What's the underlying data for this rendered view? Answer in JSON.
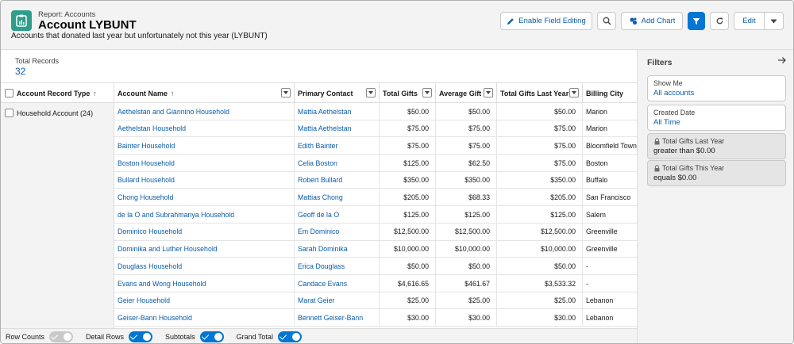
{
  "header": {
    "breadcrumb": "Report: Accounts",
    "title": "Account LYBUNT",
    "description": "Accounts that donated last year but unfortunately not this year (LYBUNT)",
    "buttons": {
      "enable_field_editing": "Enable Field Editing",
      "add_chart": "Add Chart",
      "edit": "Edit"
    }
  },
  "summary": {
    "total_records_label": "Total Records",
    "total_records_value": "32"
  },
  "table": {
    "columns": {
      "record_type": "Account Record Type",
      "account_name": "Account Name",
      "primary_contact": "Primary Contact",
      "total_gifts": "Total Gifts",
      "average_gift": "Average Gift",
      "total_gifts_last_year": "Total Gifts Last Year",
      "billing_city": "Billing City"
    },
    "sort_indicator": "↑",
    "group_label": "Household Account (24)",
    "rows": [
      {
        "account": "Aethelstan and Giannino Household",
        "contact": "Mattia Aethelstan",
        "total": "$50.00",
        "avg": "$50.00",
        "last": "$50.00",
        "city": "Marion"
      },
      {
        "account": "Aethelstan Household",
        "contact": "Mattia Aethelstan",
        "total": "$75.00",
        "avg": "$75.00",
        "last": "$75.00",
        "city": "Marion"
      },
      {
        "account": "Bainter Household",
        "contact": "Edith Bainter",
        "total": "$75.00",
        "avg": "$75.00",
        "last": "$75.00",
        "city": "Bloomfield Towns"
      },
      {
        "account": "Boston Household",
        "contact": "Celia Boston",
        "total": "$125.00",
        "avg": "$62.50",
        "last": "$75.00",
        "city": "Boston"
      },
      {
        "account": "Bullard Household",
        "contact": "Robert Bullard",
        "total": "$350.00",
        "avg": "$350.00",
        "last": "$350.00",
        "city": "Buffalo"
      },
      {
        "account": "Chong Household",
        "contact": "Mattias Chong",
        "total": "$205.00",
        "avg": "$68.33",
        "last": "$205.00",
        "city": "San Francisco"
      },
      {
        "account": "de la O and Subrahmanya Household",
        "contact": "Geoff de la O",
        "total": "$125.00",
        "avg": "$125.00",
        "last": "$125.00",
        "city": "Salem"
      },
      {
        "account": "Dominico Household",
        "contact": "Em Dominico",
        "total": "$12,500.00",
        "avg": "$12,500.00",
        "last": "$12,500.00",
        "city": "Greenville"
      },
      {
        "account": "Dominika and Luther Household",
        "contact": "Sarah Dominika",
        "total": "$10,000.00",
        "avg": "$10,000.00",
        "last": "$10,000.00",
        "city": "Greenville"
      },
      {
        "account": "Douglass Household",
        "contact": "Erica Douglass",
        "total": "$50.00",
        "avg": "$50.00",
        "last": "$50.00",
        "city": "-"
      },
      {
        "account": "Evans and Wong Household",
        "contact": "Candace Evans",
        "total": "$4,616.65",
        "avg": "$461.67",
        "last": "$3,533.32",
        "city": "-"
      },
      {
        "account": "Geier Household",
        "contact": "Marat Geier",
        "total": "$25.00",
        "avg": "$25.00",
        "last": "$25.00",
        "city": "Lebanon"
      },
      {
        "account": "Geiser-Bann Household",
        "contact": "Bennett Geiser-Bann",
        "total": "$30.00",
        "avg": "$30.00",
        "last": "$30.00",
        "city": "Lebanon"
      }
    ]
  },
  "footer": {
    "row_counts": "Row Counts",
    "detail_rows": "Detail Rows",
    "subtotals": "Subtotals",
    "grand_total": "Grand Total"
  },
  "filters": {
    "title": "Filters",
    "items": [
      {
        "label": "Show Me",
        "value": "All accounts",
        "locked": false
      },
      {
        "label": "Created Date",
        "value": "All Time",
        "locked": false
      },
      {
        "label": "Total Gifts Last Year",
        "value": "greater than $0.00",
        "locked": true
      },
      {
        "label": "Total Gifts This Year",
        "value": "equals $0.00",
        "locked": true
      }
    ]
  },
  "colors": {
    "brand_blue": "#0176d3",
    "link_blue": "#0b5cab",
    "icon_teal": "#2e9e8a"
  },
  "icons": [
    "report-icon",
    "pencil-icon",
    "search-icon",
    "add-chart-icon",
    "filter-icon",
    "refresh-icon",
    "chevron-down-icon",
    "arrow-right-icon",
    "lock-icon"
  ]
}
